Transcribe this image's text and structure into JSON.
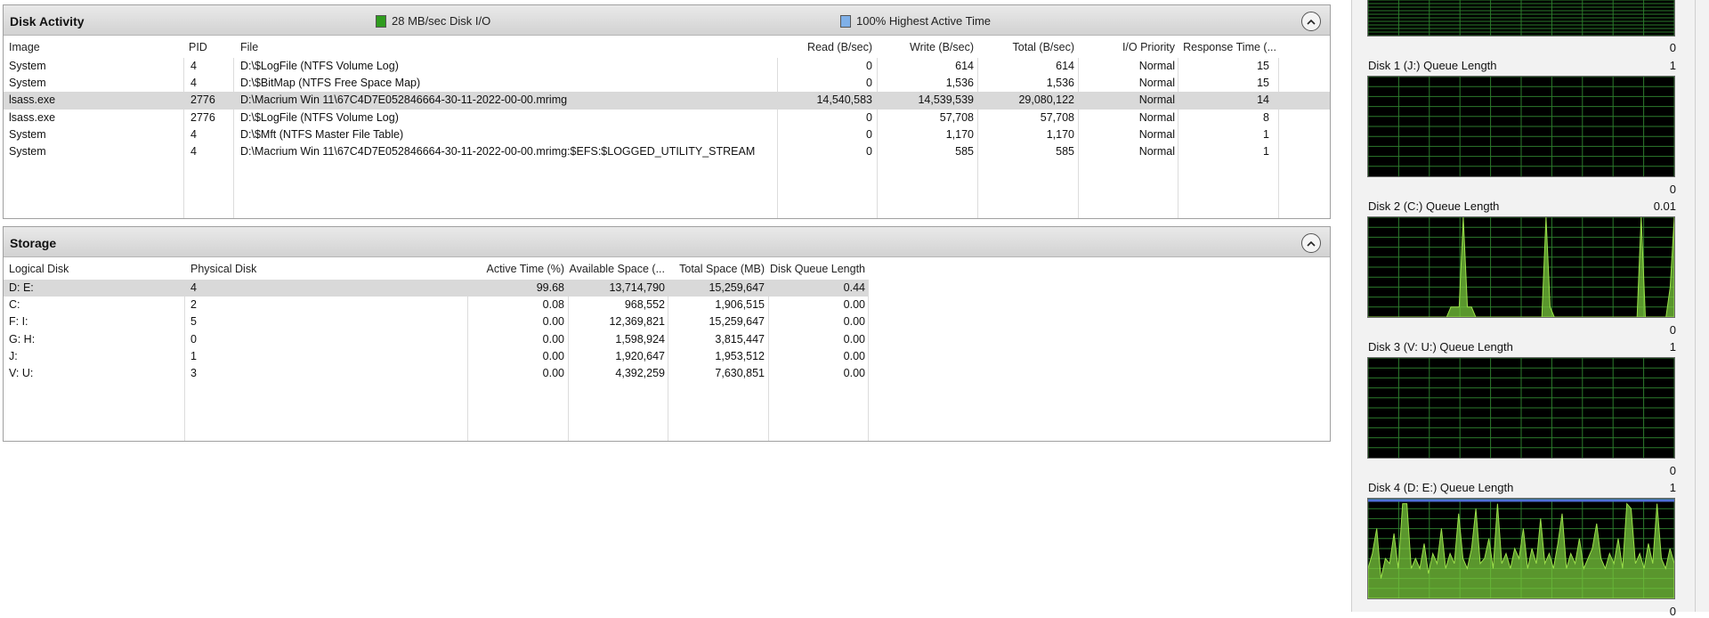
{
  "disk_activity": {
    "title": "Disk Activity",
    "legend_io": "28 MB/sec Disk I/O",
    "legend_active": "100% Highest Active Time",
    "io_color": "#2f9c1e",
    "active_color": "#7fb0e8",
    "columns": [
      "Image",
      "PID",
      "File",
      "Read (B/sec)",
      "Write (B/sec)",
      "Total (B/sec)",
      "I/O Priority",
      "Response Time (..."
    ],
    "rows": [
      {
        "image": "System",
        "pid": "4",
        "file": "D:\\$LogFile (NTFS Volume Log)",
        "read": "0",
        "write": "614",
        "total": "614",
        "priority": "Normal",
        "response": "15"
      },
      {
        "image": "System",
        "pid": "4",
        "file": "D:\\$BitMap (NTFS Free Space Map)",
        "read": "0",
        "write": "1,536",
        "total": "1,536",
        "priority": "Normal",
        "response": "15"
      },
      {
        "image": "lsass.exe",
        "pid": "2776",
        "file": "D:\\Macrium Win 11\\67C4D7E052846664-30-11-2022-00-00.mrimg",
        "read": "14,540,583",
        "write": "14,539,539",
        "total": "29,080,122",
        "priority": "Normal",
        "response": "14"
      },
      {
        "image": "lsass.exe",
        "pid": "2776",
        "file": "D:\\$LogFile (NTFS Volume Log)",
        "read": "0",
        "write": "57,708",
        "total": "57,708",
        "priority": "Normal",
        "response": "8"
      },
      {
        "image": "System",
        "pid": "4",
        "file": "D:\\$Mft (NTFS Master File Table)",
        "read": "0",
        "write": "1,170",
        "total": "1,170",
        "priority": "Normal",
        "response": "1"
      },
      {
        "image": "System",
        "pid": "4",
        "file": "D:\\Macrium Win 11\\67C4D7E052846664-30-11-2022-00-00.mrimg:$EFS:$LOGGED_UTILITY_STREAM",
        "read": "0",
        "write": "585",
        "total": "585",
        "priority": "Normal",
        "response": "1"
      }
    ]
  },
  "storage": {
    "title": "Storage",
    "columns": [
      "Logical Disk",
      "Physical Disk",
      "Active Time (%)",
      "Available Space (...",
      "Total Space (MB)",
      "Disk Queue Length"
    ],
    "rows": [
      {
        "logical": "D: E:",
        "physical": "4",
        "active": "99.68",
        "available": "13,714,790",
        "total": "15,259,647",
        "queue": "0.44"
      },
      {
        "logical": "C:",
        "physical": "2",
        "active": "0.08",
        "available": "968,552",
        "total": "1,906,515",
        "queue": "0.00"
      },
      {
        "logical": "F: I:",
        "physical": "5",
        "active": "0.00",
        "available": "12,369,821",
        "total": "15,259,647",
        "queue": "0.00"
      },
      {
        "logical": "G: H:",
        "physical": "0",
        "active": "0.00",
        "available": "1,598,924",
        "total": "3,815,447",
        "queue": "0.00"
      },
      {
        "logical": "J:",
        "physical": "1",
        "active": "0.00",
        "available": "1,920,647",
        "total": "1,953,512",
        "queue": "0.00"
      },
      {
        "logical": "V: U:",
        "physical": "3",
        "active": "0.00",
        "available": "4,392,259",
        "total": "7,630,851",
        "queue": "0.00"
      }
    ]
  },
  "graphs": {
    "top_min": "0",
    "items": [
      {
        "label": "Disk 1 (J:) Queue Length",
        "max": "1",
        "min": "0",
        "series": []
      },
      {
        "label": "Disk 2 (C:) Queue Length",
        "max": "0.01",
        "min": "0",
        "series": [
          0,
          0,
          0,
          0,
          0,
          0,
          0,
          0,
          0,
          0,
          0,
          0,
          0,
          0,
          0,
          0,
          0,
          0,
          0,
          0,
          0.1,
          0.1,
          0.1,
          1,
          0.1,
          0.1,
          0,
          0,
          0,
          0,
          0,
          0,
          0,
          0,
          0,
          0,
          0,
          0,
          0,
          0,
          0,
          0,
          0,
          1,
          0.1,
          0,
          0,
          0,
          0,
          0,
          0,
          0,
          0,
          0,
          0,
          0,
          0,
          0,
          0,
          0,
          0,
          0,
          0,
          0,
          0,
          0,
          1,
          0,
          0,
          0,
          0,
          0,
          0,
          0.3,
          1
        ]
      },
      {
        "label": "Disk 3 (V: U:) Queue Length",
        "max": "1",
        "min": "0",
        "series": []
      },
      {
        "label": "Disk 4 (D: E:) Queue Length",
        "max": "1",
        "min": "0",
        "series": [
          0.3,
          0.45,
          0.7,
          0.2,
          0.4,
          0.35,
          0.65,
          0.3,
          0.95,
          0.95,
          0.3,
          0.4,
          0.3,
          0.55,
          0.25,
          0.45,
          0.35,
          0.7,
          0.3,
          0.45,
          0.35,
          0.85,
          0.4,
          0.3,
          0.5,
          0.9,
          0.35,
          0.4,
          0.6,
          0.3,
          0.95,
          0.35,
          0.45,
          0.3,
          0.5,
          0.4,
          0.7,
          0.3,
          0.5,
          0.35,
          0.8,
          0.35,
          0.45,
          0.3,
          0.55,
          0.85,
          0.3,
          0.45,
          0.35,
          0.6,
          0.3,
          0.4,
          0.5,
          0.75,
          0.4,
          0.3,
          0.45,
          0.35,
          0.6,
          0.3,
          0.95,
          0.9,
          0.35,
          0.45,
          0.3,
          0.55,
          0.35,
          0.95,
          0.4,
          0.3,
          0.5,
          0.35
        ]
      }
    ]
  }
}
